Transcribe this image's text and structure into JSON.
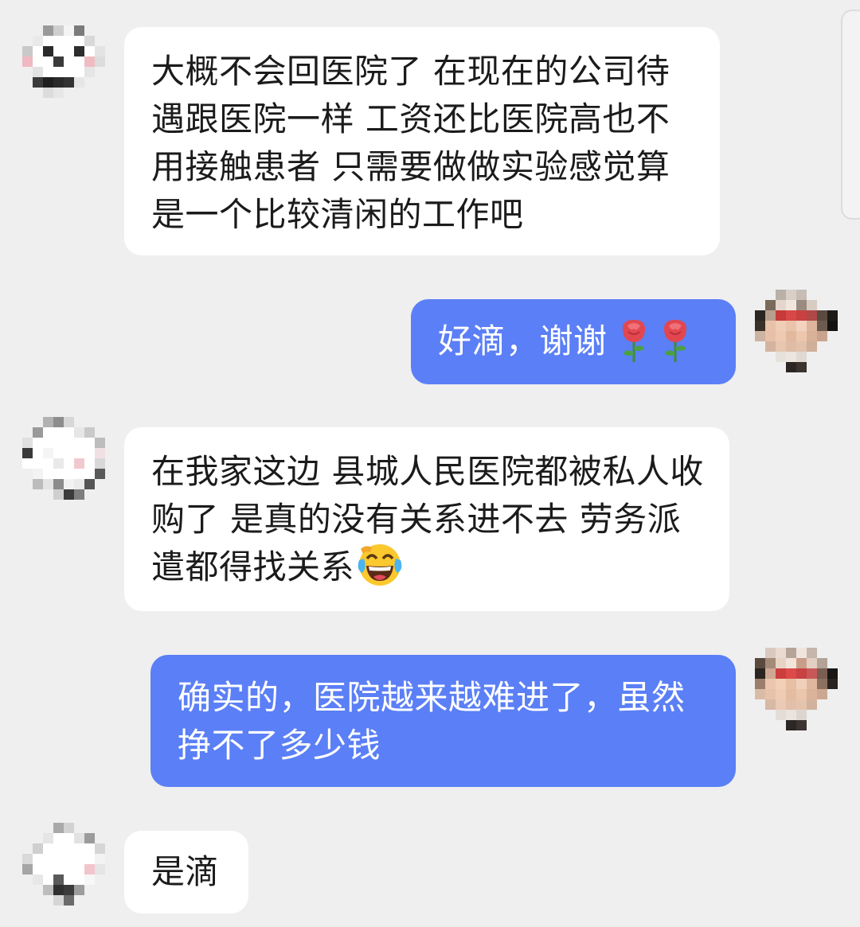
{
  "chat": {
    "messages": [
      {
        "side": "in",
        "text": "大概不会回医院了 在现在的公司待遇跟医院一样 工资还比医院高也不用接触患者 只需要做做实验感觉算是一个比较清闲的工作吧"
      },
      {
        "side": "out",
        "text": "好滴，谢谢",
        "emoji": [
          "rose-emoji",
          "rose-emoji"
        ]
      },
      {
        "side": "in",
        "text": "在我家这边 县城人民医院都被私人收购了 是真的没有关系进不去 劳务派遣都得找关系",
        "emoji": [
          "laughing-tears-emoji"
        ]
      },
      {
        "side": "out",
        "text": "确实的，医院越来越难进了，虽然挣不了多少钱"
      },
      {
        "side": "in",
        "text": "是滴"
      }
    ]
  },
  "colors": {
    "background": "#efeff0",
    "incoming_bubble": "#ffffff",
    "outgoing_bubble": "#5b7ff6",
    "incoming_text": "#1b1b1b",
    "outgoing_text": "#ffffff"
  }
}
